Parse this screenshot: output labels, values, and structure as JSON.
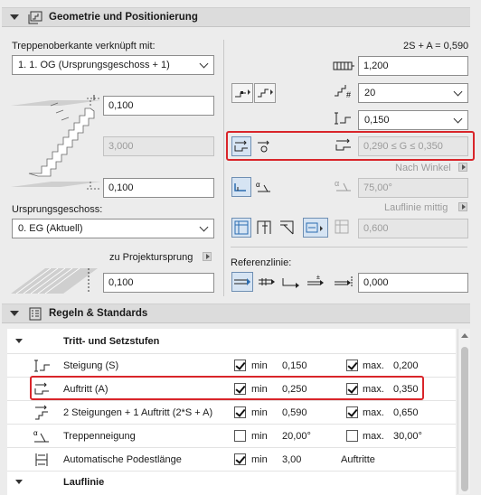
{
  "geometry": {
    "title": "Geometrie und Positionierung",
    "top_linked_label": "Treppenoberkante verknüpft mit:",
    "top_linked_value": "1. 1. OG (Ursprungsgeschoss + 1)",
    "top_offset": "0,100",
    "height": "3,000",
    "bottom_offset": "0,100",
    "home_story_label": "Ursprungsgeschoss:",
    "home_story_value": "0. EG (Aktuell)",
    "to_project_zero": "zu Projektursprung",
    "zero_offset": "0,100",
    "formula": "2S + A = 0,590",
    "flight_length": "1,200",
    "risers_count": "20",
    "riser_height": "0,150",
    "going_range": "0,290 ≤ G ≤ 0,350",
    "by_angle_label": "Nach Winkel",
    "angle_value": "75,00°",
    "walking_line_label": "Lauflinie mittig",
    "walking_line_value": "0,600",
    "reference_line_label": "Referenzlinie:",
    "reference_offset": "0,000"
  },
  "rules": {
    "title": "Regeln & Standards",
    "group_title": "Tritt- und Setzstufen",
    "min_label": "min",
    "max_label": "max.",
    "rows": [
      {
        "name": "Steigung (S)",
        "min_checked": true,
        "min": "0,150",
        "max_checked": true,
        "max_label": "max.",
        "max": "0,200"
      },
      {
        "name": "Auftritt (A)",
        "min_checked": true,
        "min": "0,250",
        "max_checked": true,
        "max_label": "max.",
        "max": "0,350"
      },
      {
        "name": "2 Steigungen + 1 Auftritt (2*S + A)",
        "min_checked": true,
        "min": "0,590",
        "max_checked": true,
        "max_label": "max.",
        "max": "0,650"
      },
      {
        "name": "Treppenneigung",
        "min_checked": false,
        "min": "20,00°",
        "max_checked": false,
        "max_label": "max.",
        "max": "30,00°"
      },
      {
        "name": "Automatische Podestlänge",
        "min_checked": true,
        "min": "3,00",
        "max_checked": null,
        "max_label": "Auftritte",
        "max": ""
      }
    ],
    "next_group": "Lauflinie"
  },
  "colors": {
    "highlight": "#d9252a",
    "active_button": "#d6e4f3",
    "icon_blue": "#2b6cb0"
  }
}
